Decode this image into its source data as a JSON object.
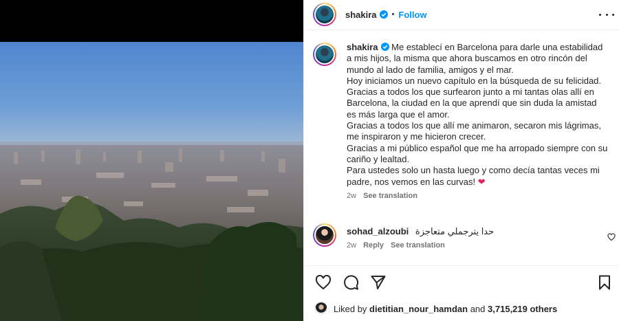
{
  "post": {
    "author": {
      "username": "shakira",
      "verified": true,
      "separator": "•",
      "follow_label": "Follow"
    },
    "caption": {
      "username": "shakira",
      "text": " Me establecí en Barcelona para darle una estabilidad a mis hijos, la misma que ahora buscamos en otro rincón del mundo al lado de familia, amigos y el mar.\nHoy iniciamos un nuevo capítulo en la búsqueda de su felicidad.\nGracias a todos los que surfearon junto a mi tantas olas allí en Barcelona, la ciudad en la que aprendí que sin duda la amistad es más larga que el amor.\nGracias a todos los que allí me animaron, secaron mis lágrimas, me inspiraron y me hicieron crecer.\nGracias a mi público español que me ha arropado siempre con su cariño y lealtad.\nPara ustedes solo un hasta luego y como decía tantas veces mi padre, nos vemos en las curvas! ",
      "emoji": "❤",
      "age": "2w",
      "see_translation": "See translation"
    },
    "comments": [
      {
        "username": "sohad_alzoubi",
        "text": "حدا يترجملي متعاجزة",
        "age": "2w",
        "reply_label": "Reply",
        "see_translation": "See translation"
      }
    ],
    "likes": {
      "prefix": "Liked by",
      "liked_by": "dietitian_nour_hamdan",
      "conjunction": "and",
      "others": "3,715,219 others"
    },
    "icons": {
      "like": "heart-icon",
      "comment": "comment-icon",
      "share": "share-icon",
      "save": "bookmark-icon",
      "more": "more-options-icon"
    },
    "colors": {
      "follow": "#0095f6",
      "verified": "#0095f6",
      "heart_emoji": "#e0245e"
    }
  }
}
